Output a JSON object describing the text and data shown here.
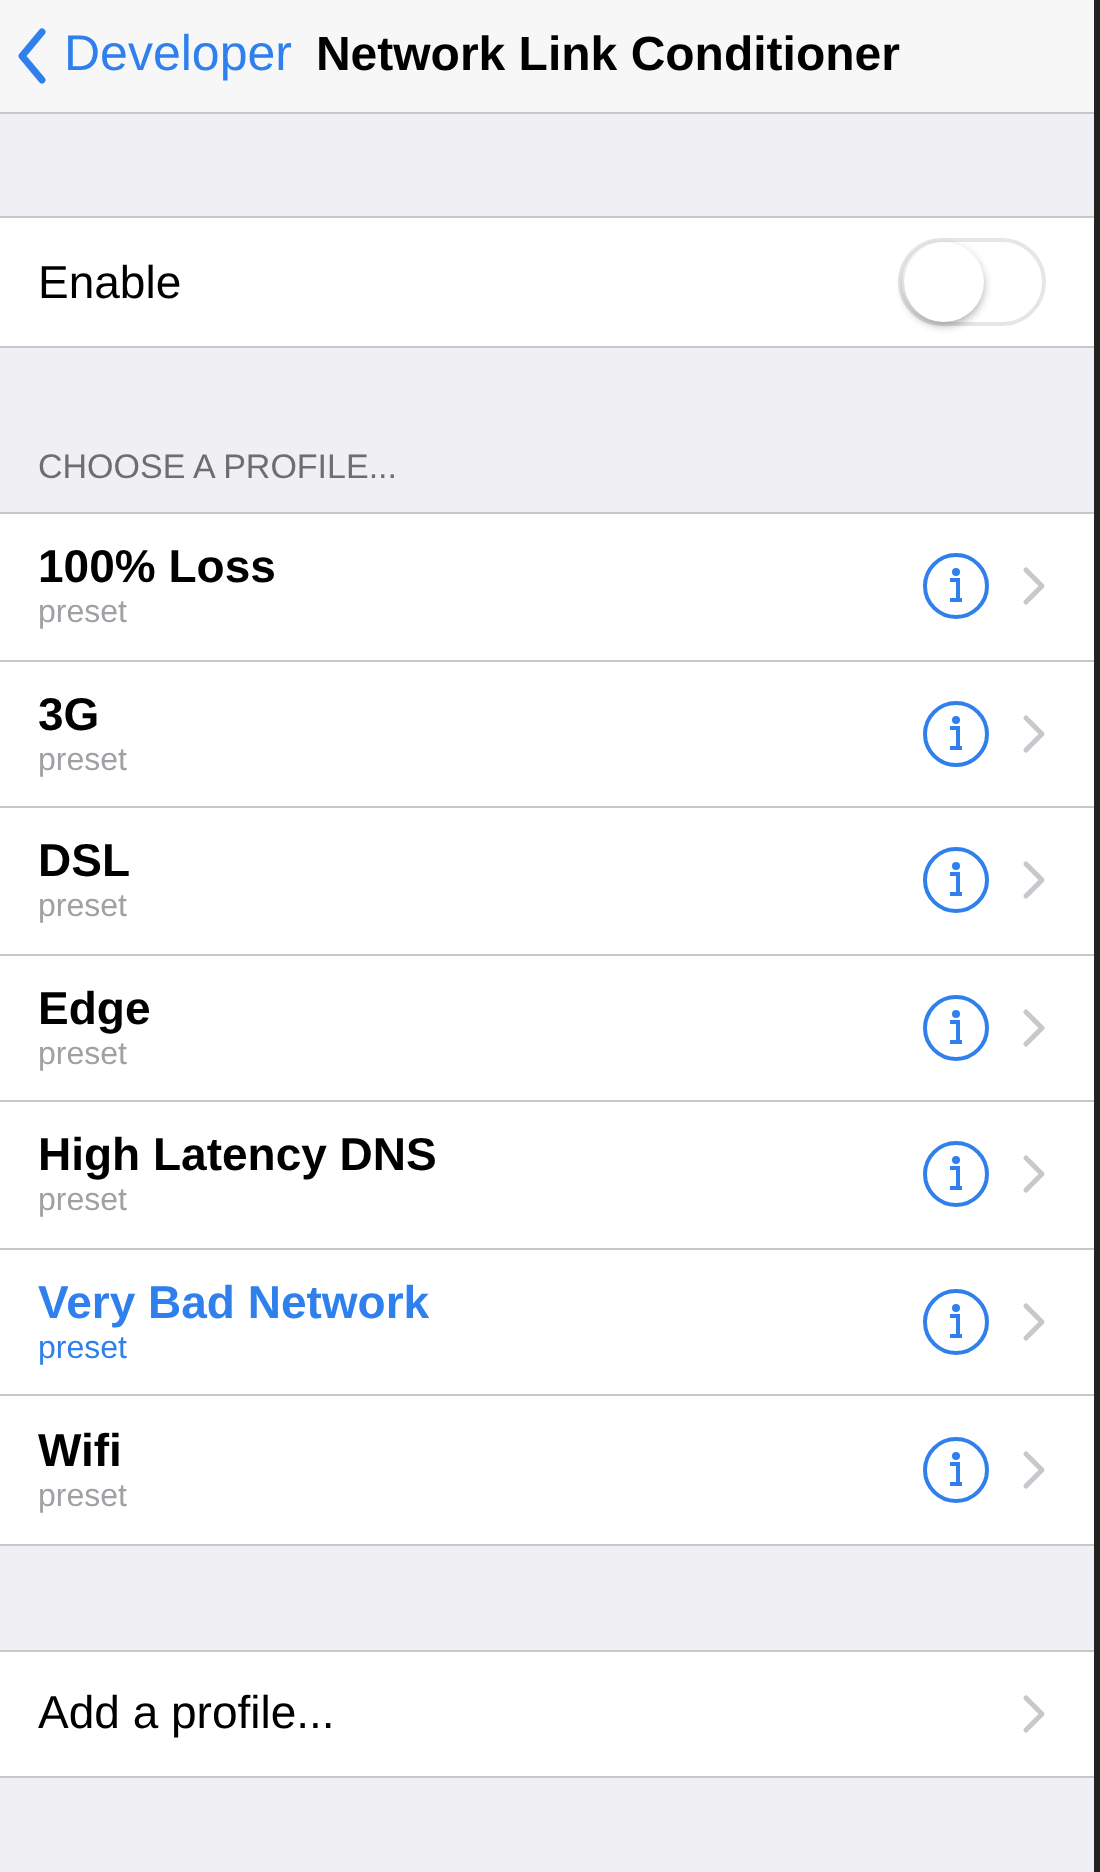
{
  "nav": {
    "back_label": "Developer",
    "title": "Network Link Conditioner"
  },
  "enable": {
    "label": "Enable",
    "on": false
  },
  "section_header": "CHOOSE A PROFILE...",
  "profiles": [
    {
      "name": "100% Loss",
      "subtitle": "preset",
      "selected": false
    },
    {
      "name": "3G",
      "subtitle": "preset",
      "selected": false
    },
    {
      "name": "DSL",
      "subtitle": "preset",
      "selected": false
    },
    {
      "name": "Edge",
      "subtitle": "preset",
      "selected": false
    },
    {
      "name": "High Latency DNS",
      "subtitle": "preset",
      "selected": false
    },
    {
      "name": "Very Bad Network",
      "subtitle": "preset",
      "selected": true
    },
    {
      "name": "Wifi",
      "subtitle": "preset",
      "selected": false
    }
  ],
  "add_profile": {
    "label": "Add a profile..."
  }
}
